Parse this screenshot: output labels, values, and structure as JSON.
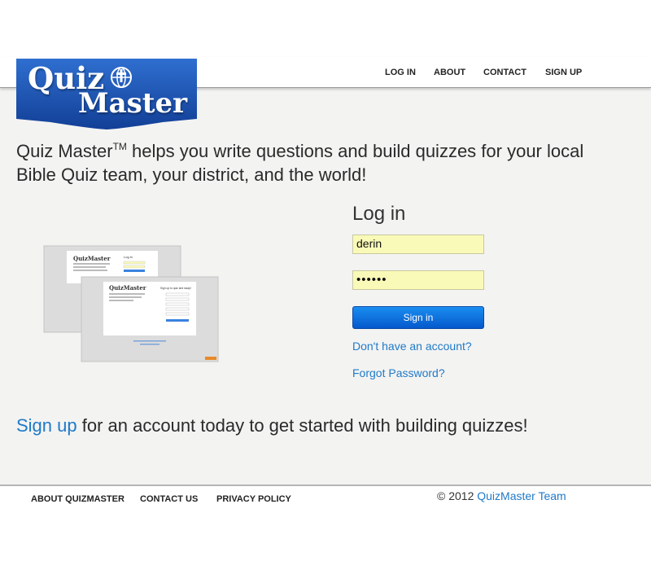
{
  "logo": {
    "line1": "Quiz",
    "line2": "Master"
  },
  "nav": [
    "LOG IN",
    "ABOUT",
    "CONTACT",
    "SIGN UP"
  ],
  "tagline": {
    "before": "Quiz Master",
    "tm": "TM",
    "after": " helps you write questions and build quizzes for your local Bible Quiz team, your district, and the world!"
  },
  "preview": {
    "back_title": "QuizMaster",
    "back_heading": "Log in",
    "front_title": "QuizMaster",
    "front_heading": "Sign up to quiz and swap!"
  },
  "login": {
    "title": "Log in",
    "username_value": "derin",
    "password_value": "••••••",
    "signin_label": "Sign in",
    "no_account_link": "Don't have an account?",
    "forgot_link": "Forgot Password?"
  },
  "signup_cta": {
    "link": "Sign up",
    "rest": " for an account today to get started with building quizzes!"
  },
  "footer": {
    "links": [
      "ABOUT QUIZMASTER",
      "CONTACT US",
      "PRIVACY POLICY"
    ],
    "copyright_prefix": "© 2012 ",
    "copyright_team": "QuizMaster Team"
  },
  "colors": {
    "brand_blue": "#1a56b3",
    "link_blue": "#1f7ac8",
    "field_yellow": "#fafab8",
    "button_blue": "#0a6fe0"
  }
}
